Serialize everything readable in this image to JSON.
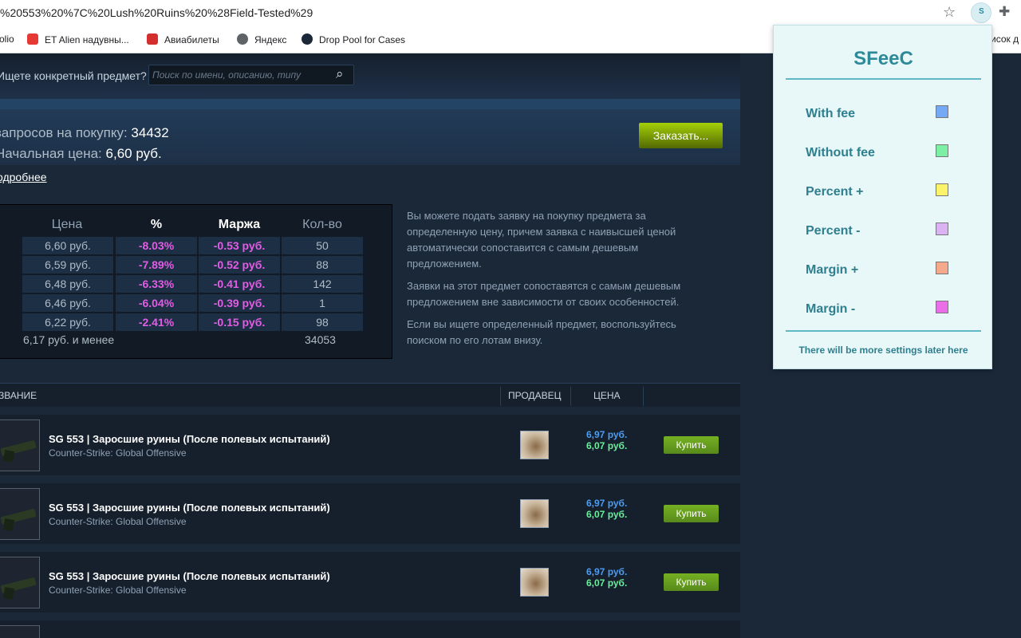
{
  "browser": {
    "url": "%20553%20%7C%20Lush%20Ruins%20%28Field-Tested%29",
    "bookmarks": [
      {
        "label": "olio",
        "color": ""
      },
      {
        "label": "ET Alien надувны...",
        "color": "#e53935"
      },
      {
        "label": "Авиабилеты",
        "color": "#d32f2f"
      },
      {
        "label": "Яндекс",
        "color": "#5f6368"
      },
      {
        "label": "Drop Pool for Cases",
        "color": "#1b2838"
      }
    ],
    "bookmark_overflow": "исок д",
    "ext_letter": "S"
  },
  "search": {
    "label": "Ищете конкретный предмет?",
    "placeholder": "Поиск по имени, описанию, типу"
  },
  "orders": {
    "requests_label": "запросов на покупку:",
    "requests_value": "34432",
    "start_label": "Начальная цена:",
    "start_value": "6,60 руб.",
    "order_button": "Заказать...",
    "more_link": "одробнее"
  },
  "orders_table": {
    "headers": {
      "price": "Цена",
      "pct": "%",
      "margin": "Маржа",
      "qty": "Кол-во"
    },
    "rows": [
      {
        "price": "6,60 руб.",
        "pct": "-8.03%",
        "margin": "-0.53 руб.",
        "qty": "50"
      },
      {
        "price": "6,59 руб.",
        "pct": "-7.89%",
        "margin": "-0.52 руб.",
        "qty": "88"
      },
      {
        "price": "6,48 руб.",
        "pct": "-6.33%",
        "margin": "-0.41 руб.",
        "qty": "142"
      },
      {
        "price": "6,46 руб.",
        "pct": "-6.04%",
        "margin": "-0.39 руб.",
        "qty": "1"
      },
      {
        "price": "6,22 руб.",
        "pct": "-2.41%",
        "margin": "-0.15 руб.",
        "qty": "98"
      }
    ],
    "footer_price": "6,17 руб. и менее",
    "footer_qty": "34053"
  },
  "description": [
    "Вы можете подать заявку на покупку предмета за определенную цену, причем заявка с наивысшей ценой автоматически сопоставится с самым дешевым предложением.",
    "Заявки на этот предмет сопоставятся с самым дешевым предложением вне зависимости от своих особенностей.",
    "Если вы ищете определенный предмет, воспользуйтесь поиском по его лотам внизу."
  ],
  "listings_header": {
    "name": "ЗВАНИЕ",
    "seller": "ПРОДАВЕЦ",
    "price": "ЦЕНА"
  },
  "listings": [
    {
      "name": "SG 553 | Заросшие руины (После полевых испытаний)",
      "game": "Counter-Strike: Global Offensive",
      "price_fee": "6,97 руб.",
      "price_nofee": "6,07 руб.",
      "buy": "Купить"
    },
    {
      "name": "SG 553 | Заросшие руины (После полевых испытаний)",
      "game": "Counter-Strike: Global Offensive",
      "price_fee": "6,97 руб.",
      "price_nofee": "6,07 руб.",
      "buy": "Купить"
    },
    {
      "name": "SG 553 | Заросшие руины (После полевых испытаний)",
      "game": "Counter-Strike: Global Offensive",
      "price_fee": "6,97 руб.",
      "price_nofee": "6,07 руб.",
      "buy": "Купить"
    }
  ],
  "popup": {
    "title": "SFeeC",
    "options": [
      {
        "label": "With fee",
        "color": "#74a9f5"
      },
      {
        "label": "Without fee",
        "color": "#7df0a6"
      },
      {
        "label": "Percent +",
        "color": "#fbf36a"
      },
      {
        "label": "Percent -",
        "color": "#dcb3f2"
      },
      {
        "label": "Margin +",
        "color": "#f3a98a"
      },
      {
        "label": "Margin -",
        "color": "#ea6ee8"
      }
    ],
    "footer": "There will be more settings later here"
  }
}
